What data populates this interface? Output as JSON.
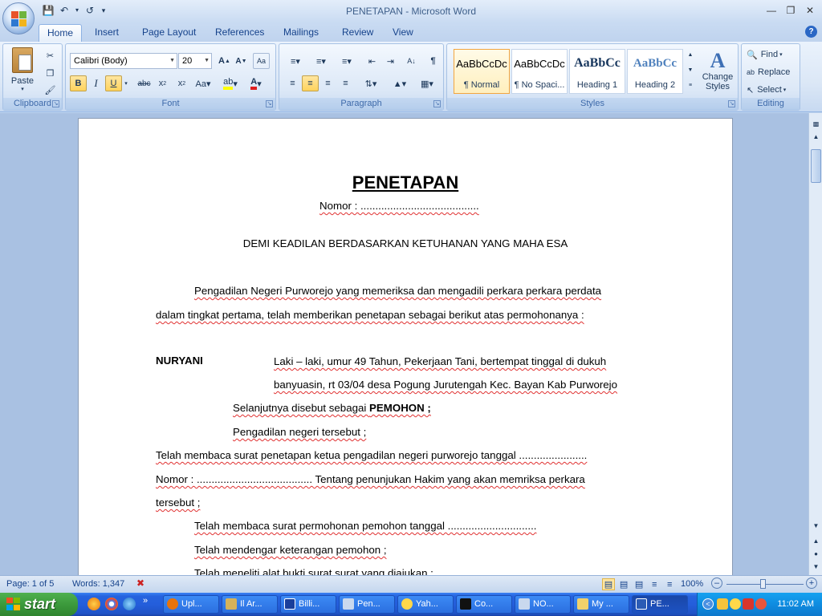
{
  "window": {
    "title": "PENETAPAN - Microsoft Word"
  },
  "tabs": [
    "Home",
    "Insert",
    "Page Layout",
    "References",
    "Mailings",
    "Review",
    "View"
  ],
  "ribbon": {
    "clipboard": {
      "label": "Clipboard",
      "paste": "Paste"
    },
    "font": {
      "label": "Font",
      "name": "Calibri (Body)",
      "size": "20"
    },
    "paragraph": {
      "label": "Paragraph"
    },
    "styles": {
      "label": "Styles",
      "items": [
        {
          "preview": "AaBbCcDc",
          "name": "¶ Normal"
        },
        {
          "preview": "AaBbCcDc",
          "name": "¶ No Spaci..."
        },
        {
          "preview": "AaBbCc",
          "name": "Heading 1"
        },
        {
          "preview": "AaBbCc",
          "name": "Heading 2"
        }
      ],
      "change_styles": "Change Styles"
    },
    "editing": {
      "label": "Editing",
      "find": "Find",
      "replace": "Replace",
      "select": "Select"
    }
  },
  "document": {
    "title": "PENETAPAN",
    "nomor": "Nomor :  ........................................",
    "demi": "DEMI KEADILAN BERDASARKAN KETUHANAN YANG MAHA ESA",
    "para1_line1": "Pengadilan Negeri Purworejo yang memeriksa dan mengadili perkara perkara perdata",
    "para1_line2": "dalam tingkat pertama, telah memberikan penetapan sebagai berikut atas permohonanya :",
    "party_name": "NURYANI",
    "party_line1": "Laki – laki, umur 49 Tahun, Pekerjaan Tani, bertempat tinggal di dukuh",
    "party_line2": "banyuasin, rt 03/04 desa Pogung Jurutengah Kec. Bayan Kab Purworejo",
    "selanjutnya": "Selanjutnya disebut sebagai ",
    "pemohon": "PEMOHON ;",
    "pengadilan": "Pengadilan negeri tersebut ;",
    "telah1": "Telah membaca surat penetapan ketua pengadilan negeri purworejo tanggal .......................",
    "nomor2": "Nomor :  ....................................... Tentang penunjukan  Hakim yang akan memriksa perkara",
    "tersebut": "tersebut ;",
    "telah2": "Telah membaca surat permohonan pemohon tanggal ..............................",
    "telah3": "Telah mendengar keterangan pemohon ;",
    "telah4": "Telah meneliti alat bukti surat surat yang diajukan ;"
  },
  "status": {
    "page": "Page: 1 of 5",
    "words": "Words: 1,347",
    "zoom": "100%"
  },
  "taskbar": {
    "start": "start",
    "tasks": [
      "Upl...",
      "Il Ar...",
      "Billi...",
      "Pen...",
      "Yah...",
      "Co...",
      "NO...",
      "My ...",
      "PE..."
    ],
    "clock": "11:02 AM"
  }
}
